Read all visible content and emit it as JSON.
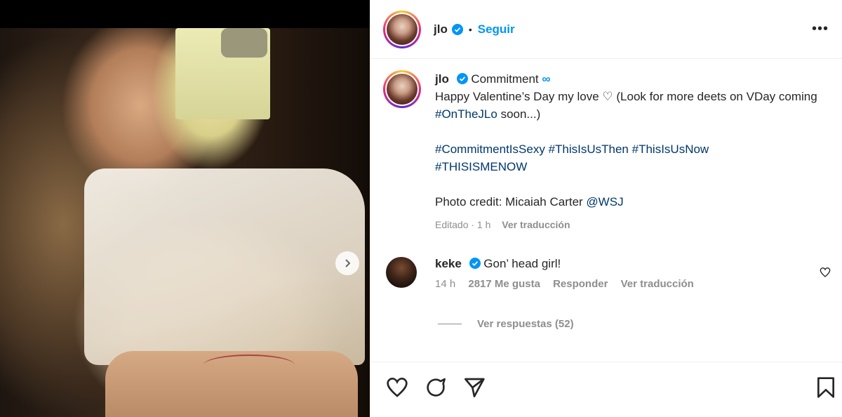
{
  "post": {
    "username": "jlo",
    "follow_label": "Seguir",
    "dot": "•",
    "more": "•••"
  },
  "caption": {
    "username": "jlo",
    "line1_text": "Commitment",
    "infinity": "∞",
    "line2_text": "Happy Valentine’s Day my love ♡ (Look for more deets on VDay coming ",
    "line2_tag": "#OnTheJLo",
    "line2_end": " soon...)",
    "tags_line1": [
      "#CommitmentIsSexy",
      "#ThisIsUsThen",
      "#ThisIsUsNow"
    ],
    "tags_line2": "#THISISMENOW",
    "credit_text": "Photo credit: Micaiah Carter ",
    "credit_tag": "@WSJ",
    "edited": "Editado · 1 h",
    "translate": "Ver traducción"
  },
  "comment": {
    "username": "keke",
    "text": "Gon’ head girl!",
    "time": "14 h",
    "likes": "2817 Me gusta",
    "reply": "Responder",
    "translate": "Ver traducción",
    "view_replies": "Ver respuestas (52)"
  },
  "colors": {
    "accent": "#0095f6",
    "hashtag": "#00376b",
    "muted": "#8e8e8e"
  },
  "icons": [
    "verified-icon",
    "more-icon",
    "next-icon",
    "heart-icon",
    "comment-icon",
    "share-icon",
    "bookmark-icon"
  ]
}
